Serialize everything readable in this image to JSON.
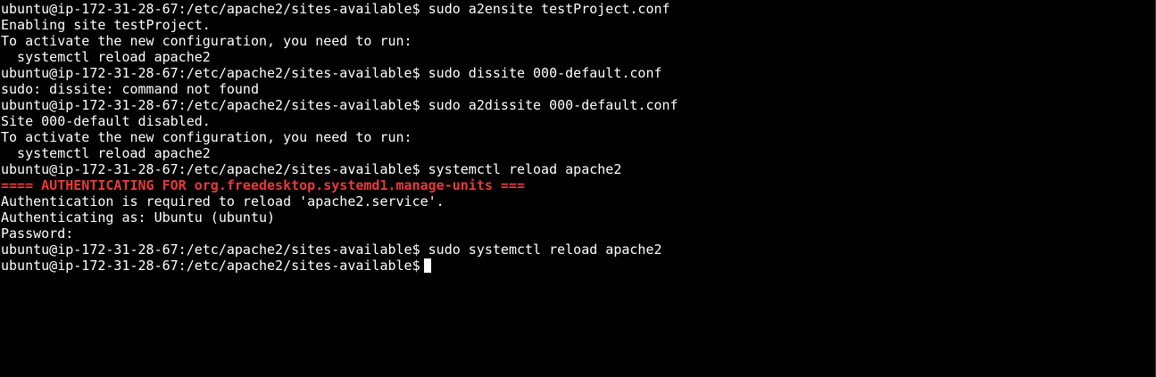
{
  "terminal": {
    "colors": {
      "background": "#000000",
      "foreground": "#ffffff",
      "error": "#e83a3a"
    },
    "lines": [
      "ubuntu@ip-172-31-28-67:/etc/apache2/sites-available$ sudo a2ensite testProject.conf",
      "Enabling site testProject.",
      "To activate the new configuration, you need to run:",
      "  systemctl reload apache2",
      "ubuntu@ip-172-31-28-67:/etc/apache2/sites-available$ sudo dissite 000-default.conf",
      "sudo: dissite: command not found",
      "ubuntu@ip-172-31-28-67:/etc/apache2/sites-available$ sudo a2dissite 000-default.conf",
      "Site 000-default disabled.",
      "To activate the new configuration, you need to run:",
      "  systemctl reload apache2",
      "ubuntu@ip-172-31-28-67:/etc/apache2/sites-available$ systemctl reload apache2",
      "==== AUTHENTICATING FOR org.freedesktop.systemd1.manage-units ===",
      "Authentication is required to reload 'apache2.service'.",
      "Authenticating as: Ubuntu (ubuntu)",
      "Password:",
      "ubuntu@ip-172-31-28-67:/etc/apache2/sites-available$ sudo systemctl reload apache2"
    ],
    "prompt": "ubuntu@ip-172-31-28-67:/etc/apache2/sites-available$"
  }
}
